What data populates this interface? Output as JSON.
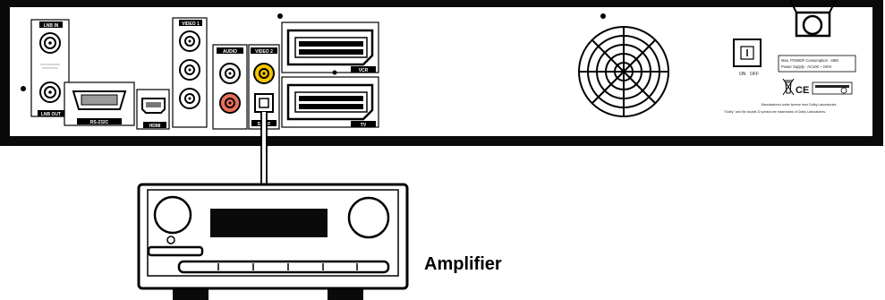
{
  "receiver": {
    "ports": {
      "lnb_in": "LNB IN",
      "lnb_out": "LNB OUT",
      "rs232": "RS-232C",
      "hdmi": "HDMI",
      "video1": "VIDEO 1",
      "audio": "AUDIO",
      "video2": "VIDEO 2",
      "spdif": "SPDIF",
      "vcr": "VCR",
      "tv": "TV"
    },
    "power_on": "ON",
    "power_off": "OFF",
    "power_rating": "Max. POWER Consumption : 48W",
    "power_supply": "Power Supply : AC100 ~ 240V",
    "dolby_line1": "Manufactured under license from Dolby Laboratories.",
    "dolby_line2": "\"Dolby\" and the double-D symbol are trademarks of Dolby Laboratories.",
    "ce_mark": "CE"
  },
  "amplifier": {
    "label": "Amplifier"
  },
  "colors": {
    "panel": "#0a0a0a",
    "inner": "#ffffff",
    "rca_white": "#f2f2f2",
    "rca_yellow": "#f4c400",
    "rca_red": "#e8705a"
  }
}
